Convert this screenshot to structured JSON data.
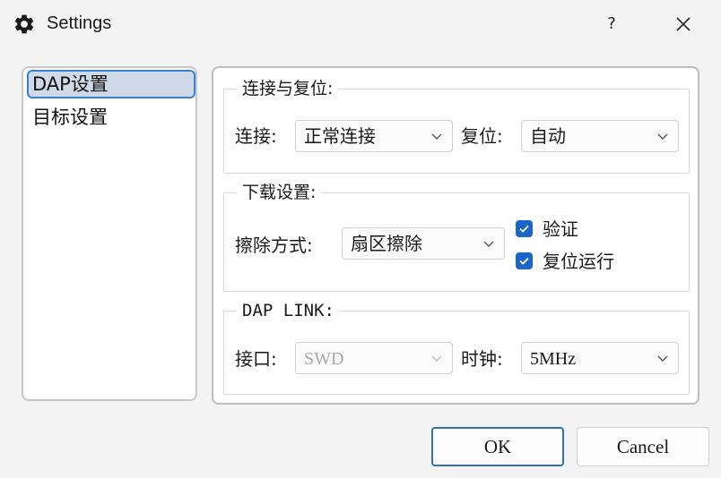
{
  "window": {
    "title": "Settings",
    "help_label": "?",
    "icons": {
      "app": "gear-icon",
      "close": "close-icon"
    }
  },
  "nav": {
    "items": [
      {
        "label": "DAP设置",
        "selected": true
      },
      {
        "label": "目标设置",
        "selected": false
      }
    ]
  },
  "groups": {
    "connect_reset": {
      "title": "连接与复位:",
      "connect_label": "连接:",
      "connect_value": "正常连接",
      "reset_label": "复位:",
      "reset_value": "自动"
    },
    "download": {
      "title": "下载设置:",
      "erase_label": "擦除方式:",
      "erase_value": "扇区擦除",
      "verify_label": "验证",
      "verify_checked": true,
      "reset_run_label": "复位运行",
      "reset_run_checked": true
    },
    "dap_link": {
      "title": "DAP LINK:",
      "interface_label": "接口:",
      "interface_value": "SWD",
      "interface_enabled": false,
      "clock_label": "时钟:",
      "clock_value": "5MHz"
    }
  },
  "buttons": {
    "ok": "OK",
    "cancel": "Cancel"
  },
  "colors": {
    "accent": "#1a66c8",
    "selection_bg": "#cfd9e8",
    "window_bg": "#f3f3f3"
  }
}
